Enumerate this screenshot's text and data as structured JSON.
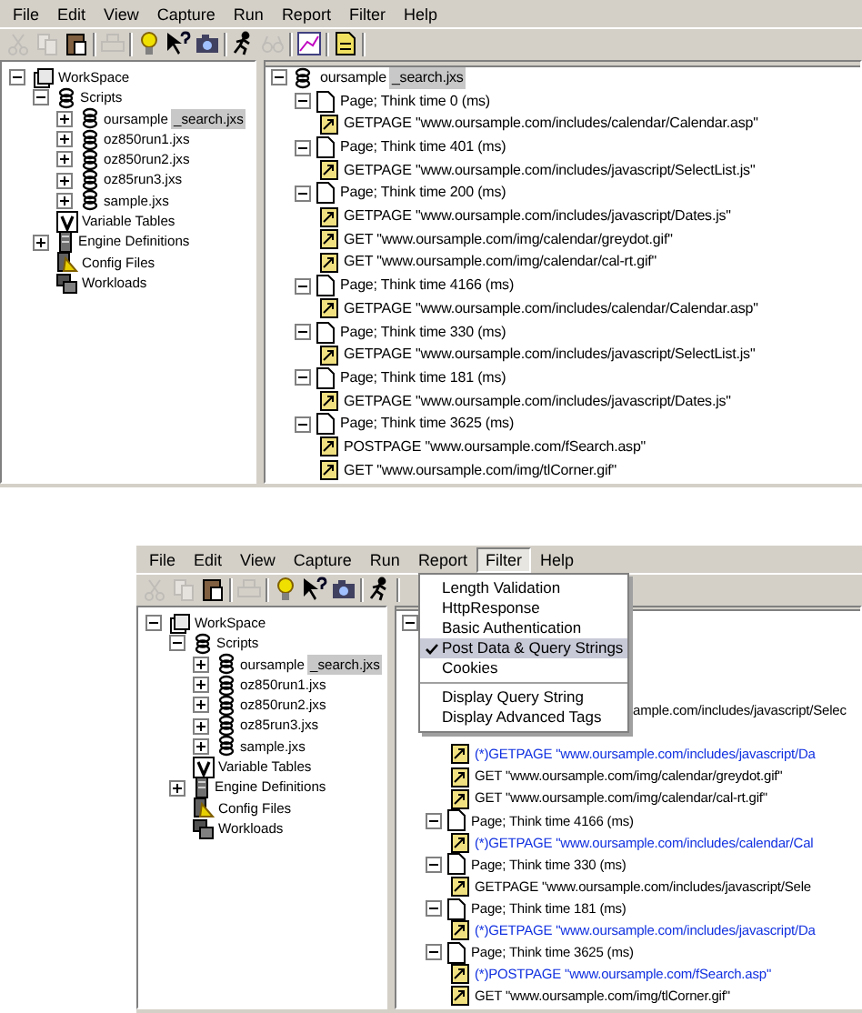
{
  "top_window": {
    "menu": [
      {
        "label": "File",
        "selected": false
      },
      {
        "label": "Edit",
        "selected": false
      },
      {
        "label": "View",
        "selected": false
      },
      {
        "label": "Capture",
        "selected": false
      },
      {
        "label": "Run",
        "selected": false
      },
      {
        "label": "Report",
        "selected": false
      },
      {
        "label": "Filter",
        "selected": false
      },
      {
        "label": "Help",
        "selected": false
      }
    ],
    "toolbar": [
      [
        {
          "kind": "cut",
          "disabled": true
        },
        {
          "kind": "copy",
          "disabled": true
        },
        {
          "kind": "paste",
          "disabled": false
        }
      ],
      [
        {
          "kind": "print",
          "disabled": true
        }
      ],
      [
        {
          "kind": "help",
          "disabled": false
        },
        {
          "kind": "whats_this",
          "disabled": false
        },
        {
          "kind": "camera",
          "disabled": false
        }
      ],
      [
        {
          "kind": "runner",
          "disabled": false
        },
        {
          "kind": "glasses",
          "disabled": true
        }
      ],
      [
        {
          "kind": "chart",
          "disabled": false
        }
      ],
      [
        {
          "kind": "report",
          "disabled": false
        }
      ]
    ],
    "workspace_tree": [
      {
        "label": "WorkSpace",
        "kind": "workspace",
        "expanded": true,
        "children": [
          {
            "label": "Scripts",
            "kind": "scripts",
            "expanded": true,
            "children": [
              {
                "label": "oursample",
                "label_selected": "_search.jxs",
                "kind": "script",
                "expanded": false
              },
              {
                "label": "oz850run1.jxs",
                "kind": "script",
                "expanded": false
              },
              {
                "label": "oz850run2.jxs",
                "kind": "script",
                "expanded": false
              },
              {
                "label": "oz85run3.jxs",
                "kind": "script",
                "expanded": false
              },
              {
                "label": "sample.jxs",
                "kind": "script",
                "expanded": false
              }
            ]
          },
          {
            "label": "Variable Tables",
            "kind": "tables"
          },
          {
            "label": "Engine Definitions",
            "kind": "engines",
            "expanded": false
          },
          {
            "label": "Config Files",
            "kind": "config"
          },
          {
            "label": "Workloads",
            "kind": "workloads"
          }
        ]
      }
    ],
    "script_tree": {
      "label": "oursample",
      "label_selected": "_search.jxs",
      "expanded": true,
      "pages": [
        {
          "label": "Page; Think time 0 (ms)",
          "expanded": true,
          "children": [
            {
              "kind": "request",
              "label": "GETPAGE \"www.oursample.com/includes/calendar/Calendar.asp\"",
              "flagged": false
            }
          ]
        },
        {
          "label": "Page; Think time 401 (ms)",
          "expanded": true,
          "children": [
            {
              "kind": "request",
              "label": "GETPAGE \"www.oursample.com/includes/javascript/SelectList.js\"",
              "flagged": false
            }
          ]
        },
        {
          "label": "Page; Think time 200 (ms)",
          "expanded": true,
          "children": [
            {
              "kind": "request",
              "label": "GETPAGE \"www.oursample.com/includes/javascript/Dates.js\"",
              "flagged": false
            },
            {
              "kind": "request",
              "label": "GET \"www.oursample.com/img/calendar/greydot.gif\"",
              "flagged": false
            },
            {
              "kind": "request",
              "label": "GET \"www.oursample.com/img/calendar/cal-rt.gif\"",
              "flagged": false
            }
          ]
        },
        {
          "label": "Page; Think time 4166 (ms)",
          "expanded": true,
          "children": [
            {
              "kind": "request",
              "label": "GETPAGE \"www.oursample.com/includes/calendar/Calendar.asp\"",
              "flagged": false
            }
          ]
        },
        {
          "label": "Page; Think time 330 (ms)",
          "expanded": true,
          "children": [
            {
              "kind": "request",
              "label": "GETPAGE \"www.oursample.com/includes/javascript/SelectList.js\"",
              "flagged": false
            }
          ]
        },
        {
          "label": "Page; Think time 181 (ms)",
          "expanded": true,
          "children": [
            {
              "kind": "request",
              "label": "GETPAGE \"www.oursample.com/includes/javascript/Dates.js\"",
              "flagged": false
            }
          ]
        },
        {
          "label": "Page; Think time 3625 (ms)",
          "expanded": true,
          "children": [
            {
              "kind": "request",
              "label": "POSTPAGE \"www.oursample.com/fSearch.asp\"",
              "flagged": false
            },
            {
              "kind": "request",
              "label": "GET \"www.oursample.com/img/tlCorner.gif\"",
              "flagged": false
            }
          ]
        }
      ]
    }
  },
  "bottom_window": {
    "menu": [
      {
        "label": "File",
        "selected": false
      },
      {
        "label": "Edit",
        "selected": false
      },
      {
        "label": "View",
        "selected": false
      },
      {
        "label": "Capture",
        "selected": false
      },
      {
        "label": "Run",
        "selected": false
      },
      {
        "label": "Report",
        "selected": false
      },
      {
        "label": "Filter",
        "selected": true
      },
      {
        "label": "Help",
        "selected": false
      }
    ],
    "toolbar": [
      [
        {
          "kind": "cut",
          "disabled": true
        },
        {
          "kind": "copy",
          "disabled": true
        },
        {
          "kind": "paste",
          "disabled": false
        }
      ],
      [
        {
          "kind": "print",
          "disabled": true
        }
      ],
      [
        {
          "kind": "help",
          "disabled": false
        },
        {
          "kind": "whats_this",
          "disabled": false
        },
        {
          "kind": "camera",
          "disabled": false
        }
      ],
      [
        {
          "kind": "runner",
          "disabled": false
        }
      ]
    ],
    "workspace_tree": [
      {
        "label": "WorkSpace",
        "kind": "workspace",
        "expanded": true,
        "children": [
          {
            "label": "Scripts",
            "kind": "scripts",
            "expanded": true,
            "children": [
              {
                "label": "oursample",
                "label_selected": "_search.jxs",
                "kind": "script",
                "expanded": false
              },
              {
                "label": "oz850run1.jxs",
                "kind": "script",
                "expanded": false
              },
              {
                "label": "oz850run2.jxs",
                "kind": "script",
                "expanded": false
              },
              {
                "label": "oz85run3.jxs",
                "kind": "script",
                "expanded": false
              },
              {
                "label": "sample.jxs",
                "kind": "script",
                "expanded": false
              }
            ]
          },
          {
            "label": "Variable Tables",
            "kind": "tables"
          },
          {
            "label": "Engine Definitions",
            "kind": "engines",
            "expanded": false
          },
          {
            "label": "Config Files",
            "kind": "config"
          },
          {
            "label": "Workloads",
            "kind": "workloads"
          }
        ]
      }
    ],
    "script_tree": {
      "expanded": true,
      "pages": [
        {
          "children": [
            {
              "kind": "partial",
              "label": "ample.com/includes/javascript/Selec",
              "flagged": false
            }
          ]
        },
        {
          "children": [
            {
              "kind": "request",
              "label": "(*)GETPAGE \"www.oursample.com/includes/javascript/Da",
              "flagged": true
            },
            {
              "kind": "request",
              "label": "GET \"www.oursample.com/img/calendar/greydot.gif\"",
              "flagged": false
            },
            {
              "kind": "request",
              "label": "GET \"www.oursample.com/img/calendar/cal-rt.gif\"",
              "flagged": false
            }
          ]
        },
        {
          "label": "Page; Think time 4166 (ms)",
          "expanded": true,
          "children": [
            {
              "kind": "request",
              "label": "(*)GETPAGE \"www.oursample.com/includes/calendar/Cal",
              "flagged": true
            }
          ]
        },
        {
          "label": "Page; Think time 330 (ms)",
          "expanded": true,
          "children": [
            {
              "kind": "request",
              "label": "GETPAGE \"www.oursample.com/includes/javascript/Sele",
              "flagged": false
            }
          ]
        },
        {
          "label": "Page; Think time 181 (ms)",
          "expanded": true,
          "children": [
            {
              "kind": "request",
              "label": "(*)GETPAGE \"www.oursample.com/includes/javascript/Da",
              "flagged": true
            }
          ]
        },
        {
          "label": "Page; Think time 3625 (ms)",
          "expanded": true,
          "children": [
            {
              "kind": "request",
              "label": "(*)POSTPAGE \"www.oursample.com/fSearch.asp\"",
              "flagged": true
            },
            {
              "kind": "request",
              "label": "GET \"www.oursample.com/img/tlCorner.gif\"",
              "flagged": false
            }
          ]
        }
      ]
    },
    "filter_menu": [
      [
        {
          "label": "Length Validation",
          "checked": false,
          "selected": false
        },
        {
          "label": "HttpResponse",
          "checked": false,
          "selected": false
        },
        {
          "label": "Basic Authentication",
          "checked": false,
          "selected": false
        },
        {
          "label": "Post Data & Query Strings",
          "checked": true,
          "selected": true
        },
        {
          "label": "Cookies",
          "checked": false,
          "selected": false
        }
      ],
      [
        {
          "label": "Display Query String",
          "checked": false,
          "selected": false
        },
        {
          "label": "Display Advanced Tags",
          "checked": false,
          "selected": false
        }
      ]
    ]
  }
}
